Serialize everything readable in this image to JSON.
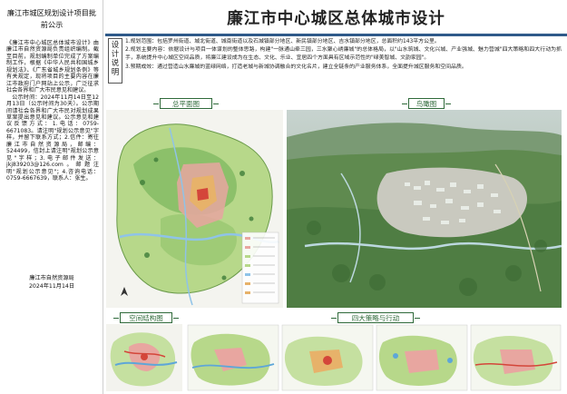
{
  "left": {
    "title": "廉江市城区规划设计项目批前公示",
    "body": "《廉江市中心城区总体城市设计》由廉江市自然资源局负责组织编制。截至目前，规划编制单位完成了方案编制工作，根据《中华人民共和国城乡规划法》、《广东省城乡规划条例》等有关规定，现将项目的主要内容在廉江市政府门户网站上公示，广泛征求社会各界和广大市民意见和建议。\n　公示时间：2024年11月14日至12月13日（公示时间为30天）。公示期间请社会各界和广大市民对规划成果草案提出意见和建议。公示意见和建议反馈方式：1.电话：0759-6671083。请注明\"规划公示意见\"字样，并留下联系方式；2.信件：寄往廉江市自然资源局，邮编：524499，信封上请注明\"规划公示意见\"字样；3.电子邮件发送：jkj839203@126.com。邮题注明\"规划公示意见\"；4.咨询电话：0759-6667639，联系人：张生。",
    "signature": [
      "廉江市自然资源局",
      "2024年11月14日"
    ]
  },
  "header": {
    "title": "廉江市中心城区总体城市设计"
  },
  "design_notes": {
    "tag": "设计说明",
    "items": [
      "1.规划范围：包括罗州街道、城北街道、城南街道以及石城镇部分地区、新民镇部分地区、吉水镇部分地区，总面积约143平方公里。",
      "2.规划主要内容：依据设计与项目一体谋划的整体思路，构建\"一脉通山牵三园，三水聚心绣廉城\"的总体格局，以\"山水筑城、文化兴城、产业强城、魅力营城\"四大策略和四大行动为抓手，系统提升中心城区空间品质，将廉江建设成为在生态、文化、乐业、宜居四个方面具有区域示范性的\"绿美智城、文韵家园\"。",
      "3.预期成效：通过营造山水廉城的蓝绿网络，打造老城与新城协调融合的文化名片，建立全链条的产业服务体系，全面提升城区服务和空间品质。"
    ]
  },
  "sections": {
    "master_plan": "总平面图",
    "aerial": "鸟瞰图",
    "spatial_structure": "空间结构图",
    "strategies": "四大策略与行动"
  },
  "colors": {
    "header_rule": "#2f5a8a",
    "label_border": "#2f6a3a",
    "green_light": "#a9cf7a",
    "green_dark": "#3f7d3a",
    "urban_pink": "#e8a6a0",
    "urban_orange": "#e7b26a",
    "water_blue": "#8fc3e8"
  }
}
